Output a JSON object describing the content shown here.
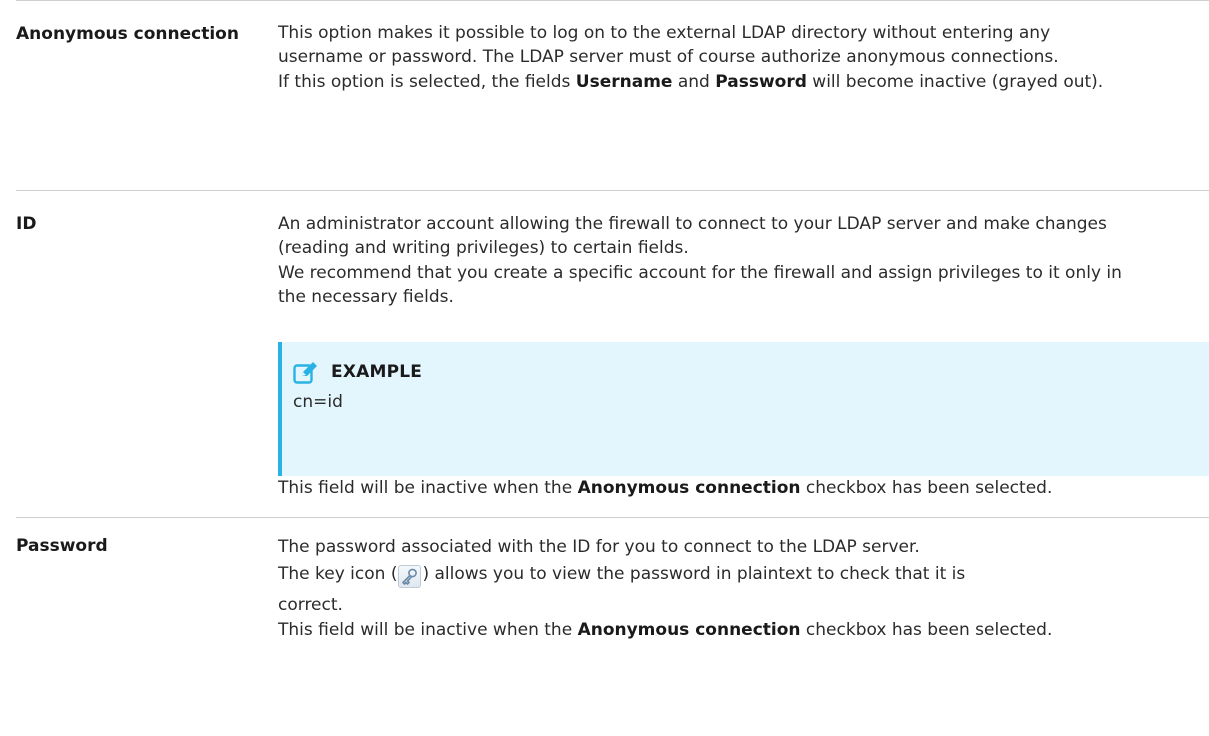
{
  "rows": [
    {
      "term": "Anonymous connection",
      "lines": [
        "This option makes it possible to log on to the external LDAP directory without entering any username or password. The LDAP server must of course authorize anonymous connections."
      ],
      "line2_pre": "If this option is selected, the fields ",
      "line2_b1": "Username",
      "line2_mid": " and ",
      "line2_b2": "Password",
      "line2_post": " will become inactive (grayed out)."
    },
    {
      "term": "ID",
      "p1": "An administrator account allowing the firewall to connect to your LDAP server and make changes (reading and writing privileges) to certain fields.",
      "p2": "We recommend that you create a specific account for the firewall and assign privileges to it only in the necessary fields.",
      "example": {
        "icon": "pencil-square-icon",
        "title": "EXAMPLE",
        "code": "cn=id",
        "accent": "#28b3e4",
        "background": "#e3f6fd"
      },
      "after_pre": "This field will be inactive when the ",
      "after_b": "Anonymous connection",
      "after_post": " checkbox has been selected."
    },
    {
      "term": "Password",
      "p1": "The password associated with the ID for you to connect to the LDAP server.",
      "p2_pre": "The key icon (",
      "p2_icon": "key-icon",
      "p2_post": ") allows you to view the password in plaintext to check that it is",
      "p3": "correct.",
      "after_pre": "This field will be inactive when the ",
      "after_b": "Anonymous connection",
      "after_post": " checkbox has been selected."
    }
  ]
}
